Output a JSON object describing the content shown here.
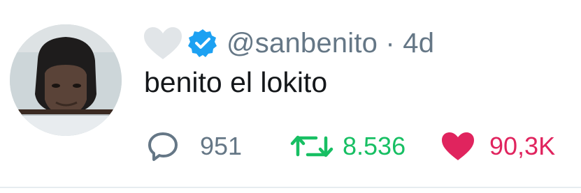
{
  "tweet": {
    "handle": "@sanbenito",
    "separator": "·",
    "age": "4d",
    "text": "benito el lokito",
    "verified": true,
    "icons": {
      "favorite_marker": "heart-icon",
      "verified": "verified-badge-icon",
      "reply": "reply-bubble-icon",
      "retweet": "retweet-icon",
      "like": "heart-icon"
    }
  },
  "actions": {
    "reply_count": "951",
    "retweet_count": "8.536",
    "like_count": "90,3K"
  },
  "colors": {
    "text": "#14171a",
    "secondary": "#657786",
    "verified": "#1da1f2",
    "retweet": "#17bf63",
    "like": "#e0245e",
    "gray_heart": "#e1e5e8"
  }
}
